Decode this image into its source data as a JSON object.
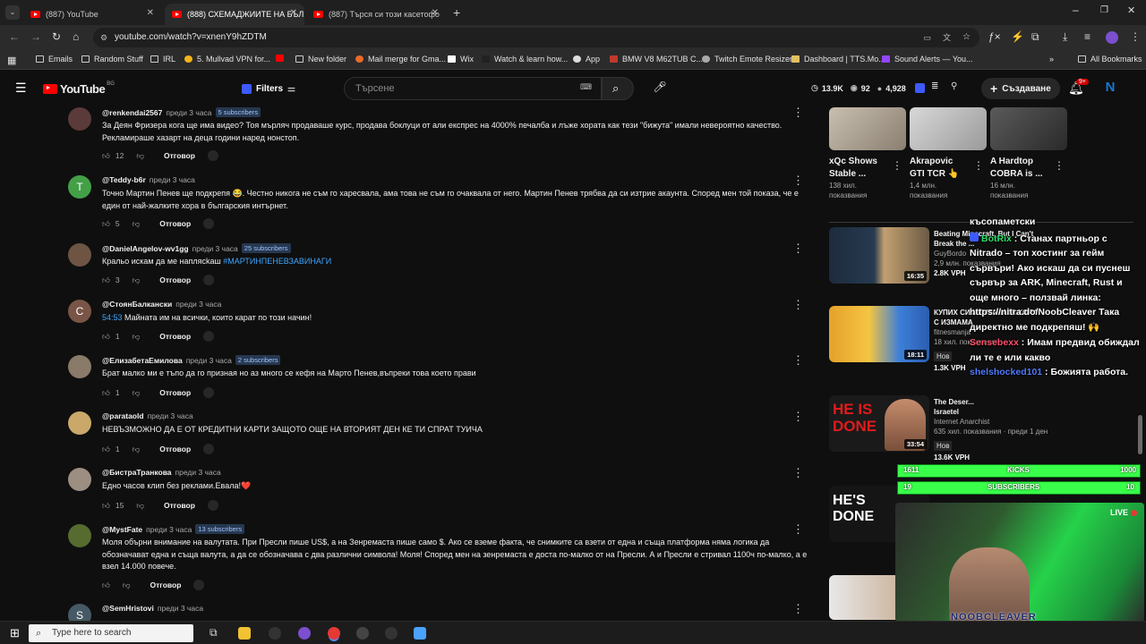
{
  "browser": {
    "tabs": [
      {
        "title": "(887) YouTube",
        "active": false
      },
      {
        "title": "(888) СХЕМАДЖИИТЕ НА БЪЛ",
        "active": true
      },
      {
        "title": "(887) Търся си този касетофо",
        "active": false
      }
    ],
    "url": "youtube.com/watch?v=xnenY9hZDTM",
    "bookmarks": [
      "Emails",
      "Random Stuff",
      "IRL",
      "5. Mullvad VPN for...",
      "New folder",
      "Mail merge for Gma...",
      "Wix",
      "Watch & learn how...",
      "App",
      "BMW V8 M62TUB C...",
      "Twitch Emote Resizer",
      "Dashboard | TTS.Mo...",
      "Sound Alerts — You...",
      "All Bookmarks"
    ]
  },
  "youtube": {
    "logo_text": "YouTube",
    "region": "BG",
    "filters_label": "Filters",
    "search_placeholder": "Търсене",
    "stats": {
      "views": "13.9K",
      "likes": "92",
      "subs": "4,928"
    },
    "create_label": "Създаване",
    "notif_badge": "9+",
    "avatar_letter": "N"
  },
  "comments": [
    {
      "user": "@renkendai2567",
      "time": "преди 3 часа",
      "badge": "5 subscribers",
      "text": "За Деян Фризера кога ще има видео? Тоя мърляч продаваше курс, продава боклуци от али експрес на 4000% печалба и лъже хората как тези \"бижута\" имали невероятно качество. Рекламираше хазарт на деца години наред нонстоп.",
      "likes": "12",
      "avatar": "",
      "avatar_color": "#5b3a3a"
    },
    {
      "user": "@Teddy-b6r",
      "time": "преди 3 часа",
      "badge": "",
      "text": "Точно Мартин Пенев ще подкрепя 😂. Честно никога не съм го харесвала, ама това не съм го очаквала от него. Мартин Пенев трябва да си изтрие акаунта. Според мен той показа, че е един от най-жалките хора в българския интърнет.",
      "likes": "5",
      "avatar": "T",
      "avatar_color": "#43a047"
    },
    {
      "user": "@DanielAngelov-wv1gg",
      "time": "преди 3 часа",
      "badge": "25 subscribers",
      "text": "Кральо искам да ме наплясkаш",
      "hashtag": "#МАРТИНПЕНЕВЗАВИНАГИ",
      "likes": "3",
      "avatar": "",
      "avatar_color": "#6d5443"
    },
    {
      "user": "@СтоянБалкански",
      "time": "преди 3 часа",
      "badge": "",
      "timestamp": "54:53",
      "text": "Майната им на всички, които карат по този начин!",
      "likes": "1",
      "avatar": "C",
      "avatar_color": "#795548"
    },
    {
      "user": "@ЕлизабетаЕмилова",
      "time": "преди 3 часа",
      "badge": "2 subscribers",
      "text": "Брат малко ми е тъпо да го призная но аз много се кефя на Марто Пенев,въпреки това което прави",
      "likes": "1",
      "avatar": "",
      "avatar_color": "#8a7a6a"
    },
    {
      "user": "@parataold",
      "time": "преди 3 часа",
      "badge": "",
      "text": "НЕВЪЗМОЖНО ДА Е ОТ КРЕДИТНИ КАРТИ ЗАЩОТО ОЩЕ НА ВТОРИЯТ ДЕН КЕ ТИ СПРАТ ТУИЧА",
      "likes": "1",
      "avatar": "",
      "avatar_color": "#c9a86a"
    },
    {
      "user": "@БистраТранкова",
      "time": "преди 3 часа",
      "badge": "",
      "text": "Едно часов клип без реклами.Евала!❤️",
      "likes": "15",
      "avatar": "",
      "avatar_color": "#9c8e80"
    },
    {
      "user": "@MystFate",
      "time": "преди 3 часа",
      "badge": "13 subscribers",
      "text": "Моля обърни внимание на валутата. При Пресли пише US$, а на Зенремаста пише само $. Ако се вземе факта, че снимките са взети от една и съща платформа няма логика да обозначават една и съща валута, а да се обозначава с два различни символа! Моля! Според мен на зенремаста е доста по-малко от на Пресли. А и Пресли е стривал 1100ч по-малко, а е взел 14.000 повече.",
      "likes": "",
      "avatar": "",
      "avatar_color": "#556b2f"
    },
    {
      "user": "@SemHristovi",
      "time": "преди 3 часа",
      "badge": "",
      "text": "",
      "likes": "",
      "avatar": "S",
      "avatar_color": "#455a64"
    }
  ],
  "reply_label": "Отговор",
  "sidebar": {
    "top_videos": [
      {
        "title1": "xQc Shows",
        "title2": "Stable ...",
        "views": "138 хил.",
        "label": "показвания"
      },
      {
        "title1": "Akrapovic",
        "title2": "GTI TCR 👆",
        "views": "1,4 млн.",
        "label": "показвания"
      },
      {
        "title1": "A Hardtop",
        "title2": "COBRA is ...",
        "views": "16 млн.",
        "label": "показвания"
      }
    ],
    "list": [
      {
        "title1": "Beating Minecraft, But I Can't",
        "title2": "Break the ...",
        "channel": "GuyBordo",
        "meta": "2,9 млн. показвания",
        "vph": "2.8K VPH",
        "dur": "16:35"
      },
      {
        "title1": "КУПИХ СИ МЕЧТАНАТА КОЛА",
        "title2": "С ИЗМАМА",
        "channel": "fitnesmanja",
        "meta": "18 хил. показвания",
        "badge": "Нов",
        "vph": "1.3K VPH",
        "dur": "18:11"
      },
      {
        "title1": "The Deser...",
        "title2": "Israetel",
        "channel": "Internet Anarchist",
        "meta": "635 хил. показвания · преди 1 ден",
        "badge": "Нов",
        "vph": "13.6K VPH",
        "dur": "33:54"
      },
      {
        "title1": "",
        "title2": "",
        "channel": "",
        "meta": "",
        "vph": "",
        "dur": ""
      }
    ],
    "thumb_texts": {
      "t3": "HE IS DONE",
      "t4": "HE'S DONE"
    }
  },
  "overlay": {
    "chat_top": "късопаметски",
    "chat": [
      {
        "user": "BotRix",
        "text": "Станах партньор с Nitrado – топ хостинг за гейм сървъри! Ако искаш да си пуснеш сървър за ARK, Minecraft, Rust и още много – ползвай линка: https://nitra.do/NoobCleaver Така директно ме подкрепяш! 🙌"
      },
      {
        "user": "Sensebexx",
        "text": "Имам предвид обиждал ли те е или какво"
      },
      {
        "user": "shelshocked101",
        "text": "Божията работа."
      }
    ],
    "kicks": {
      "left": "1611",
      "label": "KICKS",
      "right": "1000"
    },
    "subs": {
      "left": "19",
      "label": "SUBSCRIBERS",
      "right": "10"
    },
    "live": "LIVE",
    "streamer": "NOOBCLEAVER"
  },
  "taskbar": {
    "search_placeholder": "Type here to search"
  }
}
